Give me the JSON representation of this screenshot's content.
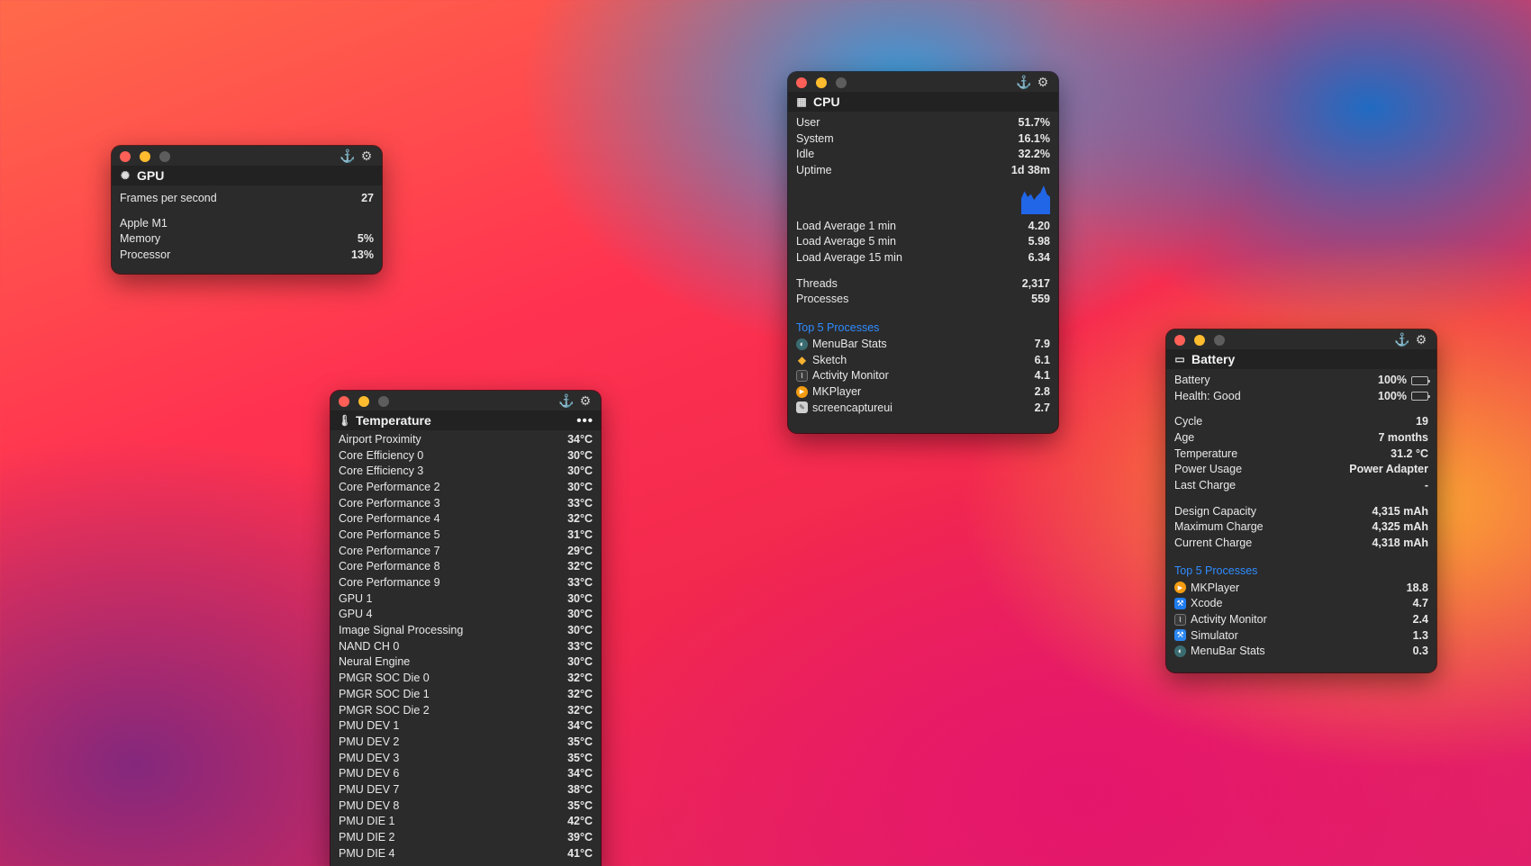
{
  "controls": {
    "anchor_icon": "⚓",
    "gear_icon": "⚙"
  },
  "gpu": {
    "title": "GPU",
    "fps": {
      "label": "Frames per second",
      "value": "27"
    },
    "device": "Apple M1",
    "rows": [
      {
        "label": "Memory",
        "value": "5%"
      },
      {
        "label": "Processor",
        "value": "13%"
      }
    ]
  },
  "cpu": {
    "title": "CPU",
    "usage": [
      {
        "label": "User",
        "value": "51.7%"
      },
      {
        "label": "System",
        "value": "16.1%"
      },
      {
        "label": "Idle",
        "value": "32.2%"
      },
      {
        "label": "Uptime",
        "value": "1d 38m"
      }
    ],
    "history_color": "#2166e6",
    "history_levels": [
      0.55,
      0.8,
      0.6,
      0.7,
      0.5,
      0.65,
      0.75,
      1.0,
      0.7,
      0.6
    ],
    "load": [
      {
        "label": "Load Average 1 min",
        "value": "4.20"
      },
      {
        "label": "Load Average 5 min",
        "value": "5.98"
      },
      {
        "label": "Load Average 15 min",
        "value": "6.34"
      }
    ],
    "counts": [
      {
        "label": "Threads",
        "value": "2,317"
      },
      {
        "label": "Processes",
        "value": "559"
      }
    ],
    "top_label": "Top 5 Processes",
    "processes": [
      {
        "name": "MenuBar Stats",
        "value": "7.9",
        "icon": "menubar-stats-icon",
        "color": "#3a6b70"
      },
      {
        "name": "Sketch",
        "value": "6.1",
        "icon": "sketch-icon",
        "color": "#f6b130"
      },
      {
        "name": "Activity Monitor",
        "value": "4.1",
        "icon": "activity-monitor-icon",
        "color": "#444"
      },
      {
        "name": "MKPlayer",
        "value": "2.8",
        "icon": "mkplayer-icon",
        "color": "#f39c12"
      },
      {
        "name": "screencaptureui",
        "value": "2.7",
        "icon": "screencapture-icon",
        "color": "#cfcfcf"
      }
    ]
  },
  "battery": {
    "title": "Battery",
    "status": [
      {
        "label": "Battery",
        "value": "100%",
        "level": 1.0,
        "color": "#34c759"
      },
      {
        "label": "Health: Good",
        "value": "100%",
        "level": 1.0,
        "color": "#bdbdbd"
      }
    ],
    "info": [
      {
        "label": "Cycle",
        "value": "19"
      },
      {
        "label": "Age",
        "value": "7 months"
      },
      {
        "label": "Temperature",
        "value": "31.2 °C"
      },
      {
        "label": "Power Usage",
        "value": "Power Adapter"
      },
      {
        "label": "Last Charge",
        "value": "-"
      }
    ],
    "capacity": [
      {
        "label": "Design Capacity",
        "value": "4,315 mAh"
      },
      {
        "label": "Maximum Charge",
        "value": "4,325 mAh"
      },
      {
        "label": "Current Charge",
        "value": "4,318 mAh"
      }
    ],
    "top_label": "Top 5 Processes",
    "processes": [
      {
        "name": "MKPlayer",
        "value": "18.8",
        "icon": "mkplayer-icon",
        "color": "#f39c12"
      },
      {
        "name": "Xcode",
        "value": "4.7",
        "icon": "xcode-icon",
        "color": "#1e7cf0"
      },
      {
        "name": "Activity Monitor",
        "value": "2.4",
        "icon": "activity-monitor-icon",
        "color": "#444"
      },
      {
        "name": "Simulator",
        "value": "1.3",
        "icon": "simulator-icon",
        "color": "#2a86f0"
      },
      {
        "name": "MenuBar Stats",
        "value": "0.3",
        "icon": "menubar-stats-icon",
        "color": "#3a6b70"
      }
    ]
  },
  "temperature": {
    "title": "Temperature",
    "more": "•••",
    "sensors": [
      {
        "label": "Airport Proximity",
        "value": "34°C"
      },
      {
        "label": "Core Efficiency 0",
        "value": "30°C"
      },
      {
        "label": "Core Efficiency 3",
        "value": "30°C"
      },
      {
        "label": "Core Performance 2",
        "value": "30°C"
      },
      {
        "label": "Core Performance 3",
        "value": "33°C"
      },
      {
        "label": "Core Performance 4",
        "value": "32°C"
      },
      {
        "label": "Core Performance 5",
        "value": "31°C"
      },
      {
        "label": "Core Performance 7",
        "value": "29°C"
      },
      {
        "label": "Core Performance 8",
        "value": "32°C"
      },
      {
        "label": "Core Performance 9",
        "value": "33°C"
      },
      {
        "label": "GPU 1",
        "value": "30°C"
      },
      {
        "label": "GPU 4",
        "value": "30°C"
      },
      {
        "label": "Image Signal Processing",
        "value": "30°C"
      },
      {
        "label": "NAND CH 0",
        "value": "33°C"
      },
      {
        "label": "Neural Engine",
        "value": "30°C"
      },
      {
        "label": "PMGR SOC Die 0",
        "value": "32°C"
      },
      {
        "label": "PMGR SOC Die 1",
        "value": "32°C"
      },
      {
        "label": "PMGR SOC Die 2",
        "value": "32°C"
      },
      {
        "label": "PMU DEV 1",
        "value": "34°C"
      },
      {
        "label": "PMU DEV 2",
        "value": "35°C"
      },
      {
        "label": "PMU DEV 3",
        "value": "35°C"
      },
      {
        "label": "PMU DEV 6",
        "value": "34°C"
      },
      {
        "label": "PMU DEV 7",
        "value": "38°C"
      },
      {
        "label": "PMU DEV 8",
        "value": "35°C"
      },
      {
        "label": "PMU DIE 1",
        "value": "42°C"
      },
      {
        "label": "PMU DIE 2",
        "value": "39°C"
      },
      {
        "label": "PMU DIE 4",
        "value": "41°C"
      }
    ]
  }
}
